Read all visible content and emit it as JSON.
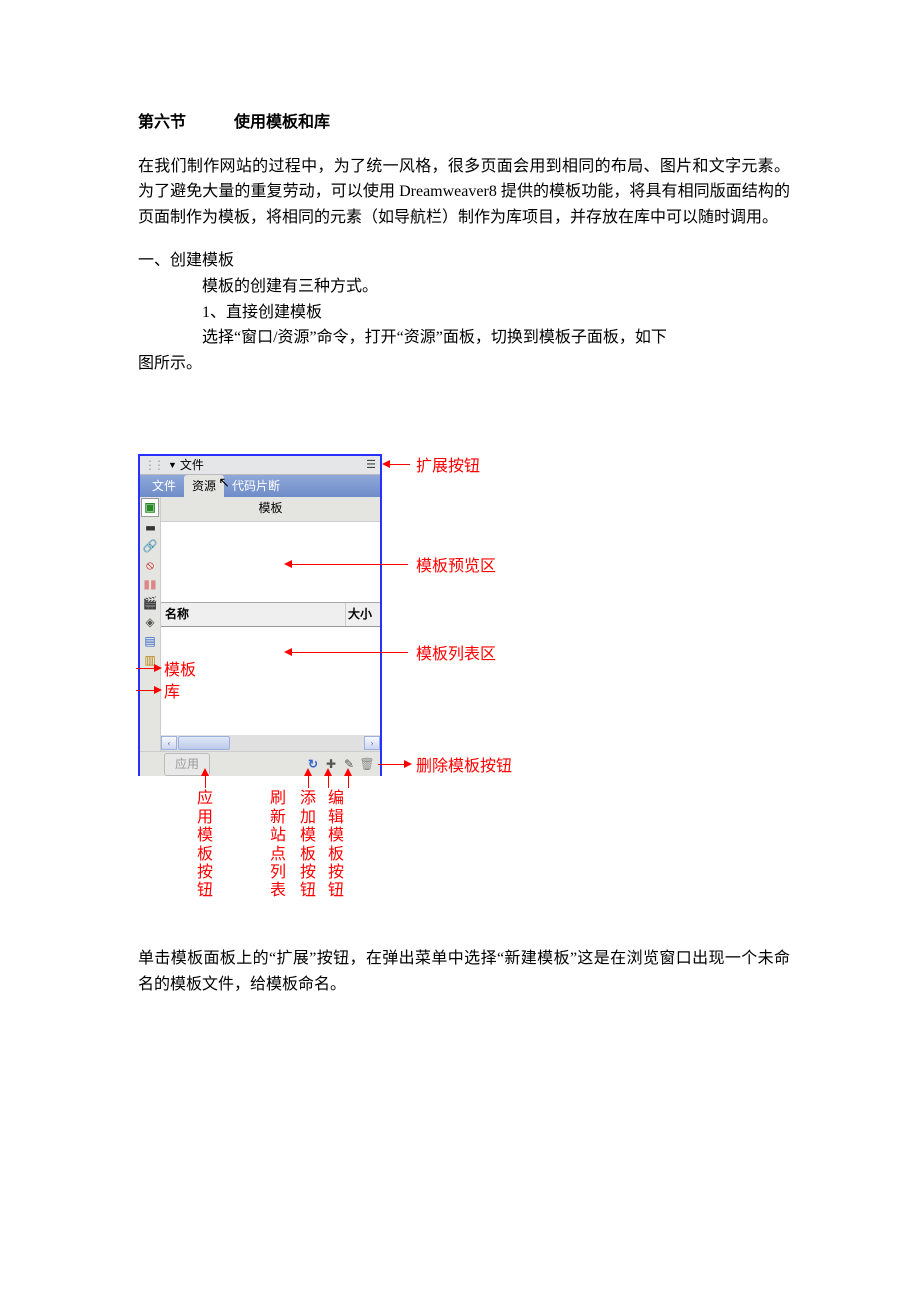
{
  "title": "第六节　　　使用模板和库",
  "para1": "在我们制作网站的过程中，为了统一风格，很多页面会用到相同的布局、图片和文字元素。为了避免大量的重复劳动，可以使用 Dreamweaver8 提供的模板功能，将具有相同版面结构的页面制作为模板，将相同的元素（如导航栏）制作为库项目，并存放在库中可以随时调用。",
  "sec1": "一、创建模板",
  "sec1_line1": "模板的创建有三种方式。",
  "sec1_line2": "1、直接创建模板",
  "sec1_line3": "选择“窗口/资源”命令，打开“资源”面板，切换到模板子面板，如下",
  "sec1_line3_cont": "图所示。",
  "panel": {
    "group_title": "文件",
    "tabs": {
      "files": "文件",
      "assets": "资源",
      "snippets": "代码片断"
    },
    "subhead": "模板",
    "list": {
      "name": "名称",
      "size": "大小"
    },
    "apply": "应用"
  },
  "callouts": {
    "expand": "扩展按钮",
    "preview": "模板预览区",
    "list": "模板列表区",
    "delete": "删除模板按钮",
    "template": "模板",
    "library": "库",
    "apply_btn": "应用模板按钮",
    "refresh": "刷新站点列表",
    "add": "添加模板按钮",
    "edit": "编辑模板按钮"
  },
  "para2": "单击模板面板上的“扩展”按钮，在弹出菜单中选择“新建模板”这是在浏览窗口出现一个未命名的模板文件，给模板命名。"
}
